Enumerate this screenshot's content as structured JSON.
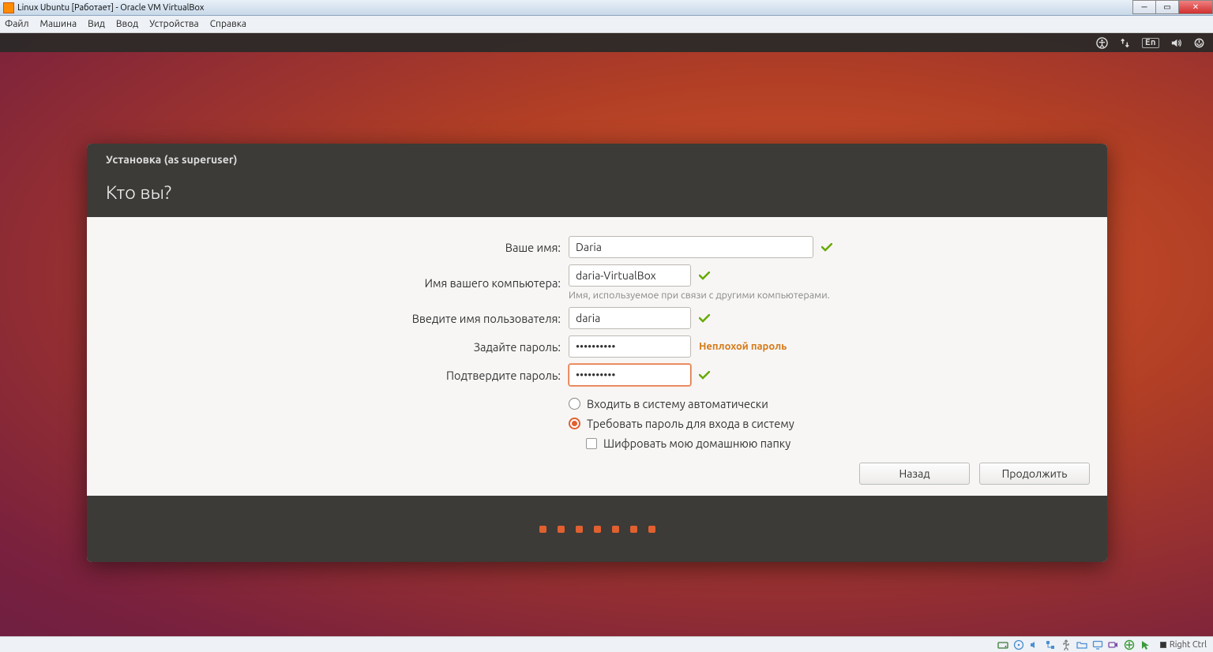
{
  "win": {
    "title": "Linux Ubuntu [Работает] - Oracle VM VirtualBox"
  },
  "vbmenu": [
    "Файл",
    "Машина",
    "Вид",
    "Ввод",
    "Устройства",
    "Справка"
  ],
  "topbar": {
    "lang": "En"
  },
  "installer": {
    "window_title": "Установка (as superuser)",
    "heading": "Кто вы?",
    "labels": {
      "name": "Ваше имя:",
      "computer": "Имя вашего компьютера:",
      "computer_hint": "Имя, используемое при связи с другими компьютерами.",
      "username": "Введите имя пользователя:",
      "password": "Задайте пароль:",
      "confirm": "Подтвердите пароль:"
    },
    "values": {
      "name": "Daria",
      "computer": "daria-VirtualBox",
      "username": "daria",
      "password": "••••••••••",
      "confirm": "••••••••••",
      "pw_strength": "Неплохой пароль"
    },
    "options": {
      "auto_login": "Входить в систему автоматически",
      "require_pw": "Требовать пароль для входа в систему",
      "encrypt_home": "Шифровать мою домашнюю папку"
    },
    "buttons": {
      "back": "Назад",
      "next": "Продолжить"
    }
  },
  "statusbar": {
    "hostkey": "Right Ctrl"
  }
}
